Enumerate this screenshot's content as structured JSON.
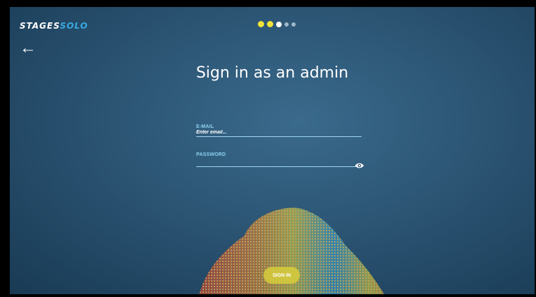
{
  "header": {
    "logo_part1": "STAGES",
    "logo_part2": "SOLO",
    "progress_step": 3,
    "progress_total": 5,
    "back_icon": "arrow-left-icon"
  },
  "main": {
    "title": "Sign in as an admin",
    "email": {
      "label": "E-MAIL",
      "placeholder": "Enter email...",
      "value": ""
    },
    "password": {
      "label": "PASSWORD",
      "value": "",
      "toggle_icon": "eye-icon"
    },
    "signin_label": "SIGN IN"
  },
  "colors": {
    "accent": "#f2e33a",
    "brand_blue": "#3aa9e0",
    "field_line": "#9fd6ee"
  }
}
